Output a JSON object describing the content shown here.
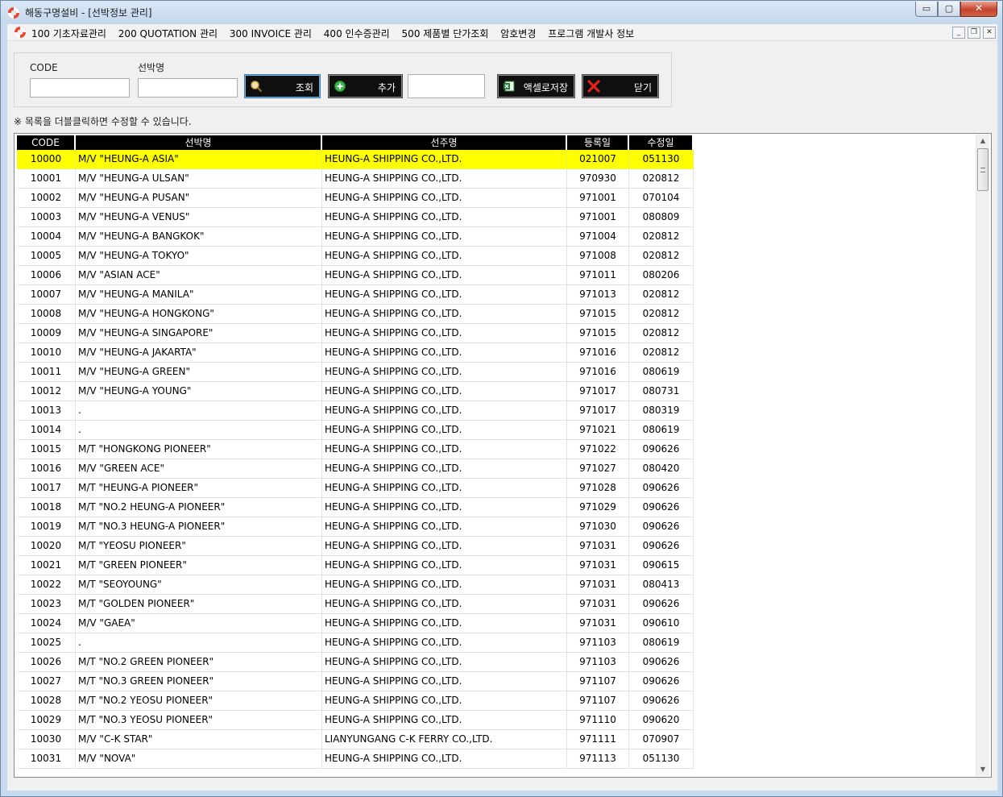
{
  "window": {
    "title": "해동구명설비 - [선박정보 관리]",
    "controls": {
      "minimize": "▭",
      "maximize": "▢",
      "close": "✕"
    }
  },
  "menu": {
    "items": [
      "100 기초자료관리",
      "200 QUOTATION 관리",
      "300 INVOICE 관리",
      "400 인수증관리",
      "500 제품별 단가조회",
      "암호변경",
      "프로그램 개발사 정보"
    ],
    "mdi": {
      "minimize": "_",
      "restore": "❐",
      "close": "✕"
    }
  },
  "search": {
    "code_label": "CODE",
    "code_value": "",
    "ship_label": "선박명",
    "ship_value": "",
    "extra_value": "",
    "buttons": {
      "search": "조회",
      "add": "추가",
      "excel": "액셀로저장",
      "close": "닫기"
    }
  },
  "notice": "※ 목록을 더블클릭하면 수정할 수 있습니다.",
  "grid": {
    "headers": [
      "CODE",
      "선박명",
      "선주명",
      "등록일",
      "수정일"
    ],
    "selected_color": "#ffff00",
    "rows": [
      [
        "10000",
        "M/V \"HEUNG-A ASIA\"",
        "HEUNG-A SHIPPING CO.,LTD.",
        "021007",
        "051130"
      ],
      [
        "10001",
        "M/V \"HEUNG-A ULSAN\"",
        "HEUNG-A SHIPPING CO.,LTD.",
        "970930",
        "020812"
      ],
      [
        "10002",
        "M/V \"HEUNG-A PUSAN\"",
        "HEUNG-A SHIPPING CO.,LTD.",
        "971001",
        "070104"
      ],
      [
        "10003",
        "M/V \"HEUNG-A VENUS\"",
        "HEUNG-A SHIPPING CO.,LTD.",
        "971001",
        "080809"
      ],
      [
        "10004",
        "M/V \"HEUNG-A BANGKOK\"",
        "HEUNG-A SHIPPING CO.,LTD.",
        "971004",
        "020812"
      ],
      [
        "10005",
        "M/V \"HEUNG-A TOKYO\"",
        "HEUNG-A SHIPPING CO.,LTD.",
        "971008",
        "020812"
      ],
      [
        "10006",
        "M/V \"ASIAN ACE\"",
        "HEUNG-A SHIPPING CO.,LTD.",
        "971011",
        "080206"
      ],
      [
        "10007",
        "M/V \"HEUNG-A MANILA\"",
        "HEUNG-A SHIPPING CO.,LTD.",
        "971013",
        "020812"
      ],
      [
        "10008",
        "M/V \"HEUNG-A HONGKONG\"",
        "HEUNG-A SHIPPING CO.,LTD.",
        "971015",
        "020812"
      ],
      [
        "10009",
        "M/V \"HEUNG-A SINGAPORE\"",
        "HEUNG-A SHIPPING CO.,LTD.",
        "971015",
        "020812"
      ],
      [
        "10010",
        "M/V \"HEUNG-A JAKARTA\"",
        "HEUNG-A SHIPPING CO.,LTD.",
        "971016",
        "020812"
      ],
      [
        "10011",
        "M/V \"HEUNG-A GREEN\"",
        "HEUNG-A SHIPPING CO.,LTD.",
        "971016",
        "080619"
      ],
      [
        "10012",
        "M/V \"HEUNG-A YOUNG\"",
        "HEUNG-A SHIPPING CO.,LTD.",
        "971017",
        "080731"
      ],
      [
        "10013",
        ".",
        "HEUNG-A SHIPPING CO.,LTD.",
        "971017",
        "080319"
      ],
      [
        "10014",
        ".",
        "HEUNG-A SHIPPING CO.,LTD.",
        "971021",
        "080619"
      ],
      [
        "10015",
        "M/T \"HONGKONG PIONEER\"",
        "HEUNG-A SHIPPING CO.,LTD.",
        "971022",
        "090626"
      ],
      [
        "10016",
        "M/V \"GREEN ACE\"",
        "HEUNG-A SHIPPING CO.,LTD.",
        "971027",
        "080420"
      ],
      [
        "10017",
        "M/T \"HEUNG-A PIONEER\"",
        "HEUNG-A SHIPPING CO.,LTD.",
        "971028",
        "090626"
      ],
      [
        "10018",
        "M/T \"NO.2 HEUNG-A PIONEER\"",
        "HEUNG-A SHIPPING CO.,LTD.",
        "971029",
        "090626"
      ],
      [
        "10019",
        "M/T \"NO.3 HEUNG-A PIONEER\"",
        "HEUNG-A SHIPPING CO.,LTD.",
        "971030",
        "090626"
      ],
      [
        "10020",
        "M/T \"YEOSU PIONEER\"",
        "HEUNG-A SHIPPING CO.,LTD.",
        "971031",
        "090626"
      ],
      [
        "10021",
        "M/T \"GREEN PIONEER\"",
        "HEUNG-A SHIPPING CO.,LTD.",
        "971031",
        "090615"
      ],
      [
        "10022",
        "M/T \"SEOYOUNG\"",
        "HEUNG-A SHIPPING CO.,LTD.",
        "971031",
        "080413"
      ],
      [
        "10023",
        "M/T \"GOLDEN PIONEER\"",
        "HEUNG-A SHIPPING CO.,LTD.",
        "971031",
        "090626"
      ],
      [
        "10024",
        "M/V \"GAEA\"",
        "HEUNG-A SHIPPING CO.,LTD.",
        "971031",
        "090610"
      ],
      [
        "10025",
        ".",
        "HEUNG-A SHIPPING CO.,LTD.",
        "971103",
        "080619"
      ],
      [
        "10026",
        "M/T \"NO.2 GREEN PIONEER\"",
        "HEUNG-A SHIPPING CO.,LTD.",
        "971103",
        "090626"
      ],
      [
        "10027",
        "M/T \"NO.3 GREEN PIONEER\"",
        "HEUNG-A SHIPPING CO.,LTD.",
        "971107",
        "090626"
      ],
      [
        "10028",
        "M/T \"NO.2 YEOSU PIONEER\"",
        "HEUNG-A SHIPPING CO.,LTD.",
        "971107",
        "090626"
      ],
      [
        "10029",
        "M/T \"NO.3 YEOSU PIONEER\"",
        "HEUNG-A SHIPPING CO.,LTD.",
        "971110",
        "090620"
      ],
      [
        "10030",
        "M/V \"C-K STAR\"",
        "LIANYUNGANG C-K FERRY CO.,LTD.",
        "971111",
        "070907"
      ],
      [
        "10031",
        "M/V \"NOVA\"",
        "HEUNG-A SHIPPING CO.,LTD.",
        "971113",
        "051130"
      ]
    ]
  },
  "scrollbar": {
    "up": "▲",
    "down": "▼"
  }
}
